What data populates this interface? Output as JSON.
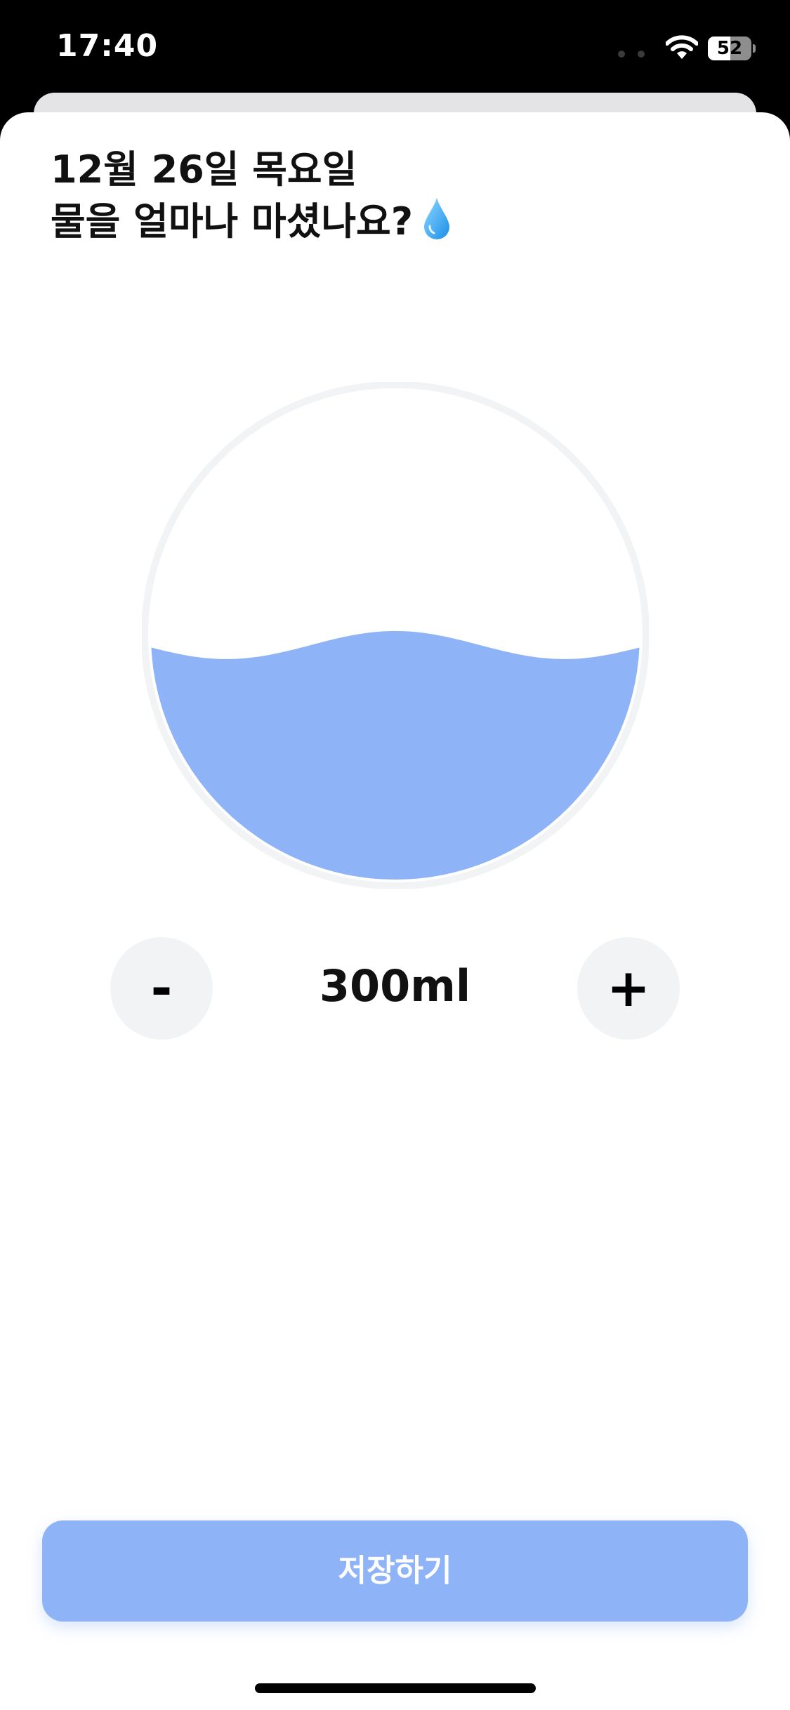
{
  "status_bar": {
    "time": "17:40",
    "battery_level": "52",
    "battery_fraction": 0.52,
    "icons": [
      "signal-dots-icon",
      "wifi-icon",
      "battery-icon"
    ]
  },
  "heading": {
    "date_line": "12월 26일 목요일",
    "question_line": "물을 얼마나 마셨나요?",
    "emoji_icon": "water-drop-icon"
  },
  "gauge": {
    "fill_fraction": 0.48,
    "water_color": "#8eb4f7",
    "ring_color": "#f2f3f5"
  },
  "stepper": {
    "minus_label": "-",
    "plus_label": "+",
    "amount": "300ml"
  },
  "save_button": {
    "label": "저장하기",
    "color": "#8eb4f7"
  }
}
